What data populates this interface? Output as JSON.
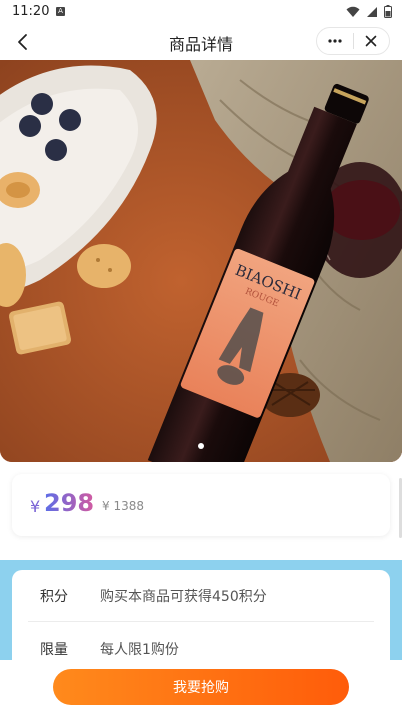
{
  "status_bar": {
    "time": "11:20",
    "icons": [
      "notification-a-icon",
      "wifi-icon",
      "cellular-signal-icon",
      "battery-icon"
    ]
  },
  "nav": {
    "title": "商品详情",
    "back_icon": "chevron-left-icon",
    "more_icon": "more-dots-icon",
    "close_icon": "close-icon"
  },
  "hero": {
    "image_label_brand": "BIAOSHI",
    "image_label_sub": "ROUGE",
    "pagination": {
      "total": 1,
      "current": 1
    }
  },
  "price": {
    "currency": "¥",
    "current": "298",
    "original": "¥ 1388"
  },
  "info": {
    "rows": [
      {
        "label": "积分",
        "value": "购买本商品可获得450积分"
      },
      {
        "label": "限量",
        "value": "每人限1购份"
      }
    ]
  },
  "action": {
    "buy_label": "我要抢购"
  },
  "colors": {
    "accent_orange": "#ff6a10",
    "price_gradient_start": "#5b6ee8",
    "price_gradient_end": "#d25aa0",
    "section_blue": "#8dd1ee"
  }
}
